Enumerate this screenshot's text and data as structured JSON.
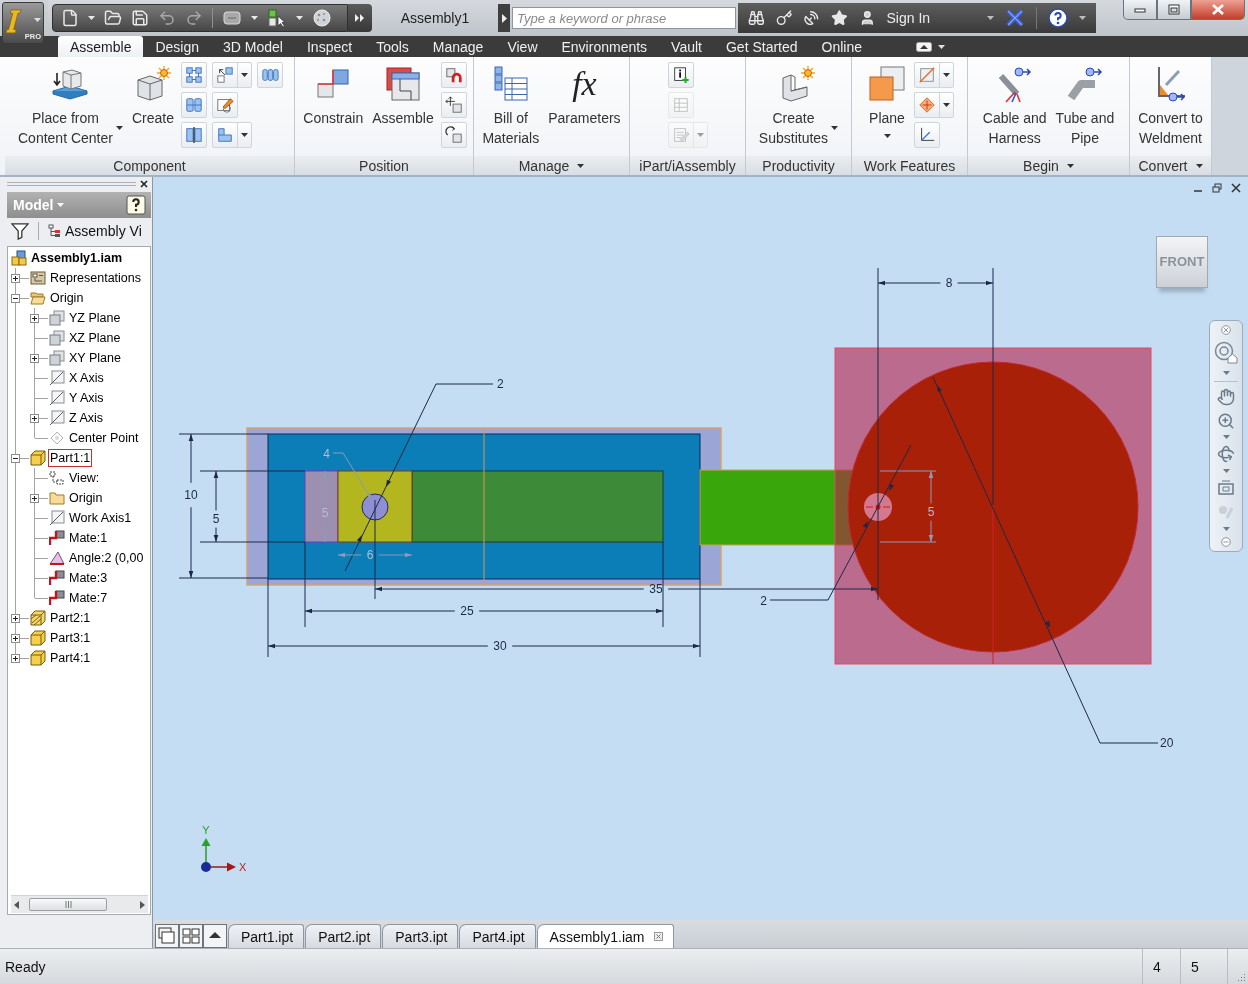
{
  "app": {
    "edition": "PRO"
  },
  "title_bar": {
    "title": "Assembly1",
    "search": {
      "placeholder": "Type a keyword or phrase"
    },
    "user": "Sign In"
  },
  "tabs": [
    {
      "label": "Assemble",
      "selected": true
    },
    {
      "label": "Design",
      "selected": false
    },
    {
      "label": "3D Model",
      "selected": false
    },
    {
      "label": "Inspect",
      "selected": false
    },
    {
      "label": "Tools",
      "selected": false
    },
    {
      "label": "Manage",
      "selected": false
    },
    {
      "label": "View",
      "selected": false
    },
    {
      "label": "Environments",
      "selected": false
    },
    {
      "label": "Vault",
      "selected": false
    },
    {
      "label": "Get Started",
      "selected": false
    },
    {
      "label": "Online",
      "selected": false
    }
  ],
  "ribbon": {
    "panels": [
      {
        "title": "Component",
        "menu": false,
        "tools": [
          {
            "kind": "large",
            "label": "Place from\nContent Center",
            "dropdown": true
          },
          {
            "kind": "large",
            "label": "Create",
            "dropdown": false
          },
          {
            "kind": "stack",
            "items": [
              {
                "dropdown": false,
                "disabled": false
              },
              {
                "dropdown": false,
                "disabled": false
              },
              {
                "dropdown": false,
                "disabled": false
              }
            ]
          },
          {
            "kind": "stack",
            "items": [
              {
                "dropdown": true,
                "disabled": false
              },
              {
                "dropdown": false,
                "disabled": false
              },
              {
                "dropdown": true,
                "disabled": false
              }
            ]
          },
          {
            "kind": "stack",
            "items": [
              {
                "dropdown": false,
                "disabled": false
              }
            ]
          }
        ]
      },
      {
        "title": "Position",
        "menu": false,
        "tools": [
          {
            "kind": "large",
            "label": "Constrain",
            "dropdown": false
          },
          {
            "kind": "large",
            "label": "Assemble",
            "dropdown": false
          },
          {
            "kind": "stack",
            "items": [
              {
                "dropdown": false,
                "disabled": false
              },
              {
                "dropdown": false,
                "disabled": false
              },
              {
                "dropdown": false,
                "disabled": false
              }
            ]
          }
        ]
      },
      {
        "title": "Manage",
        "menu": true,
        "tools": [
          {
            "kind": "large",
            "label": "Bill of\nMaterials",
            "dropdown": false
          },
          {
            "kind": "large",
            "label": "Parameters",
            "glyph": "fx",
            "dropdown": false
          }
        ]
      },
      {
        "title": "iPart/iAssembly",
        "menu": false,
        "tools": [
          {
            "kind": "stack",
            "items": [
              {
                "dropdown": false,
                "disabled": false
              },
              {
                "dropdown": false,
                "disabled": true
              },
              {
                "dropdown": true,
                "disabled": true
              }
            ]
          }
        ]
      },
      {
        "title": "Productivity",
        "menu": false,
        "tools": [
          {
            "kind": "large",
            "label": "Create\nSubstitutes",
            "dropdown": true
          }
        ]
      },
      {
        "title": "Work Features",
        "menu": false,
        "tools": [
          {
            "kind": "large",
            "label": "Plane",
            "dropdown": true
          },
          {
            "kind": "stack",
            "items": [
              {
                "dropdown": true,
                "disabled": false
              },
              {
                "dropdown": true,
                "disabled": false
              },
              {
                "dropdown": false,
                "disabled": false
              }
            ]
          }
        ]
      },
      {
        "title": "Begin",
        "menu": true,
        "tools": [
          {
            "kind": "large",
            "label": "Cable and\nHarness",
            "dropdown": false
          },
          {
            "kind": "large",
            "label": "Tube and\nPipe",
            "dropdown": false
          }
        ]
      },
      {
        "title": "Convert",
        "menu": true,
        "tools": [
          {
            "kind": "large",
            "label": "Convert to\nWeldment",
            "dropdown": false
          }
        ]
      }
    ]
  },
  "browser": {
    "title": "Model",
    "view": "Assembly Vi",
    "tree": [
      {
        "label": "Assembly1.iam",
        "kind": "assembly",
        "selected": false,
        "children": [
          {
            "label": "Representations",
            "kind": "representations",
            "selected": false,
            "expanded": false
          },
          {
            "label": "Origin",
            "kind": "folder",
            "selected": false,
            "expanded": true,
            "children": [
              {
                "label": "YZ Plane",
                "kind": "plane",
                "selected": false,
                "expanded": false
              },
              {
                "label": "XZ Plane",
                "kind": "plane",
                "selected": false
              },
              {
                "label": "XY Plane",
                "kind": "plane",
                "selected": false,
                "expanded": false
              },
              {
                "label": "X Axis",
                "kind": "axis",
                "selected": false
              },
              {
                "label": "Y Axis",
                "kind": "axis",
                "selected": false
              },
              {
                "label": "Z Axis",
                "kind": "axis",
                "selected": false,
                "expanded": false
              },
              {
                "label": "Center Point",
                "kind": "point",
                "selected": false
              }
            ]
          },
          {
            "label": "Part1:1",
            "kind": "part",
            "selected": true,
            "expanded": true,
            "children": [
              {
                "label": "View:",
                "kind": "view",
                "selected": false
              },
              {
                "label": "Origin",
                "kind": "folder",
                "selected": false,
                "expanded": false
              },
              {
                "label": "Work Axis1",
                "kind": "axis",
                "selected": false
              },
              {
                "label": "Mate:1",
                "kind": "mate",
                "selected": false
              },
              {
                "label": "Angle:2 (0,00",
                "kind": "angle",
                "selected": false
              },
              {
                "label": "Mate:3",
                "kind": "mate",
                "selected": false
              },
              {
                "label": "Mate:7",
                "kind": "mate",
                "selected": false
              }
            ]
          },
          {
            "label": "Part2:1",
            "kind": "hatchedpart",
            "selected": false,
            "expanded": false
          },
          {
            "label": "Part3:1",
            "kind": "part",
            "selected": false,
            "expanded": false
          },
          {
            "label": "Part4:1",
            "kind": "part",
            "selected": false,
            "expanded": false
          }
        ]
      }
    ]
  },
  "viewport": {
    "view_cube": "FRONT",
    "annotations": [
      {
        "kind": "linear",
        "label": "8",
        "dimmed": false
      },
      {
        "kind": "leader",
        "label": "2",
        "dimmed": false
      },
      {
        "kind": "leader",
        "label": "4",
        "dimmed": true
      },
      {
        "kind": "linear",
        "label": "10",
        "dimmed": false
      },
      {
        "kind": "linear",
        "label": "5",
        "dimmed": false
      },
      {
        "kind": "linear",
        "label": "5",
        "dimmed": true
      },
      {
        "kind": "linear",
        "label": "5",
        "dimmed": true
      },
      {
        "kind": "linear",
        "label": "6",
        "dimmed": true
      },
      {
        "kind": "linear",
        "label": "35",
        "dimmed": false
      },
      {
        "kind": "leader",
        "label": "2",
        "dimmed": false
      },
      {
        "kind": "linear",
        "label": "25",
        "dimmed": false
      },
      {
        "kind": "linear",
        "label": "30",
        "dimmed": false
      },
      {
        "kind": "leader",
        "label": "20",
        "dimmed": false
      }
    ],
    "axes": {
      "y": "Y",
      "x": "X"
    }
  },
  "document_tabs": [
    {
      "label": "Part1.ipt",
      "selected": false
    },
    {
      "label": "Part2.ipt",
      "selected": false
    },
    {
      "label": "Part3.ipt",
      "selected": false
    },
    {
      "label": "Part4.ipt",
      "selected": false
    },
    {
      "label": "Assembly1.iam",
      "selected": true
    }
  ],
  "status_bar": {
    "message": "Ready",
    "fields": [
      "4",
      "5"
    ]
  }
}
